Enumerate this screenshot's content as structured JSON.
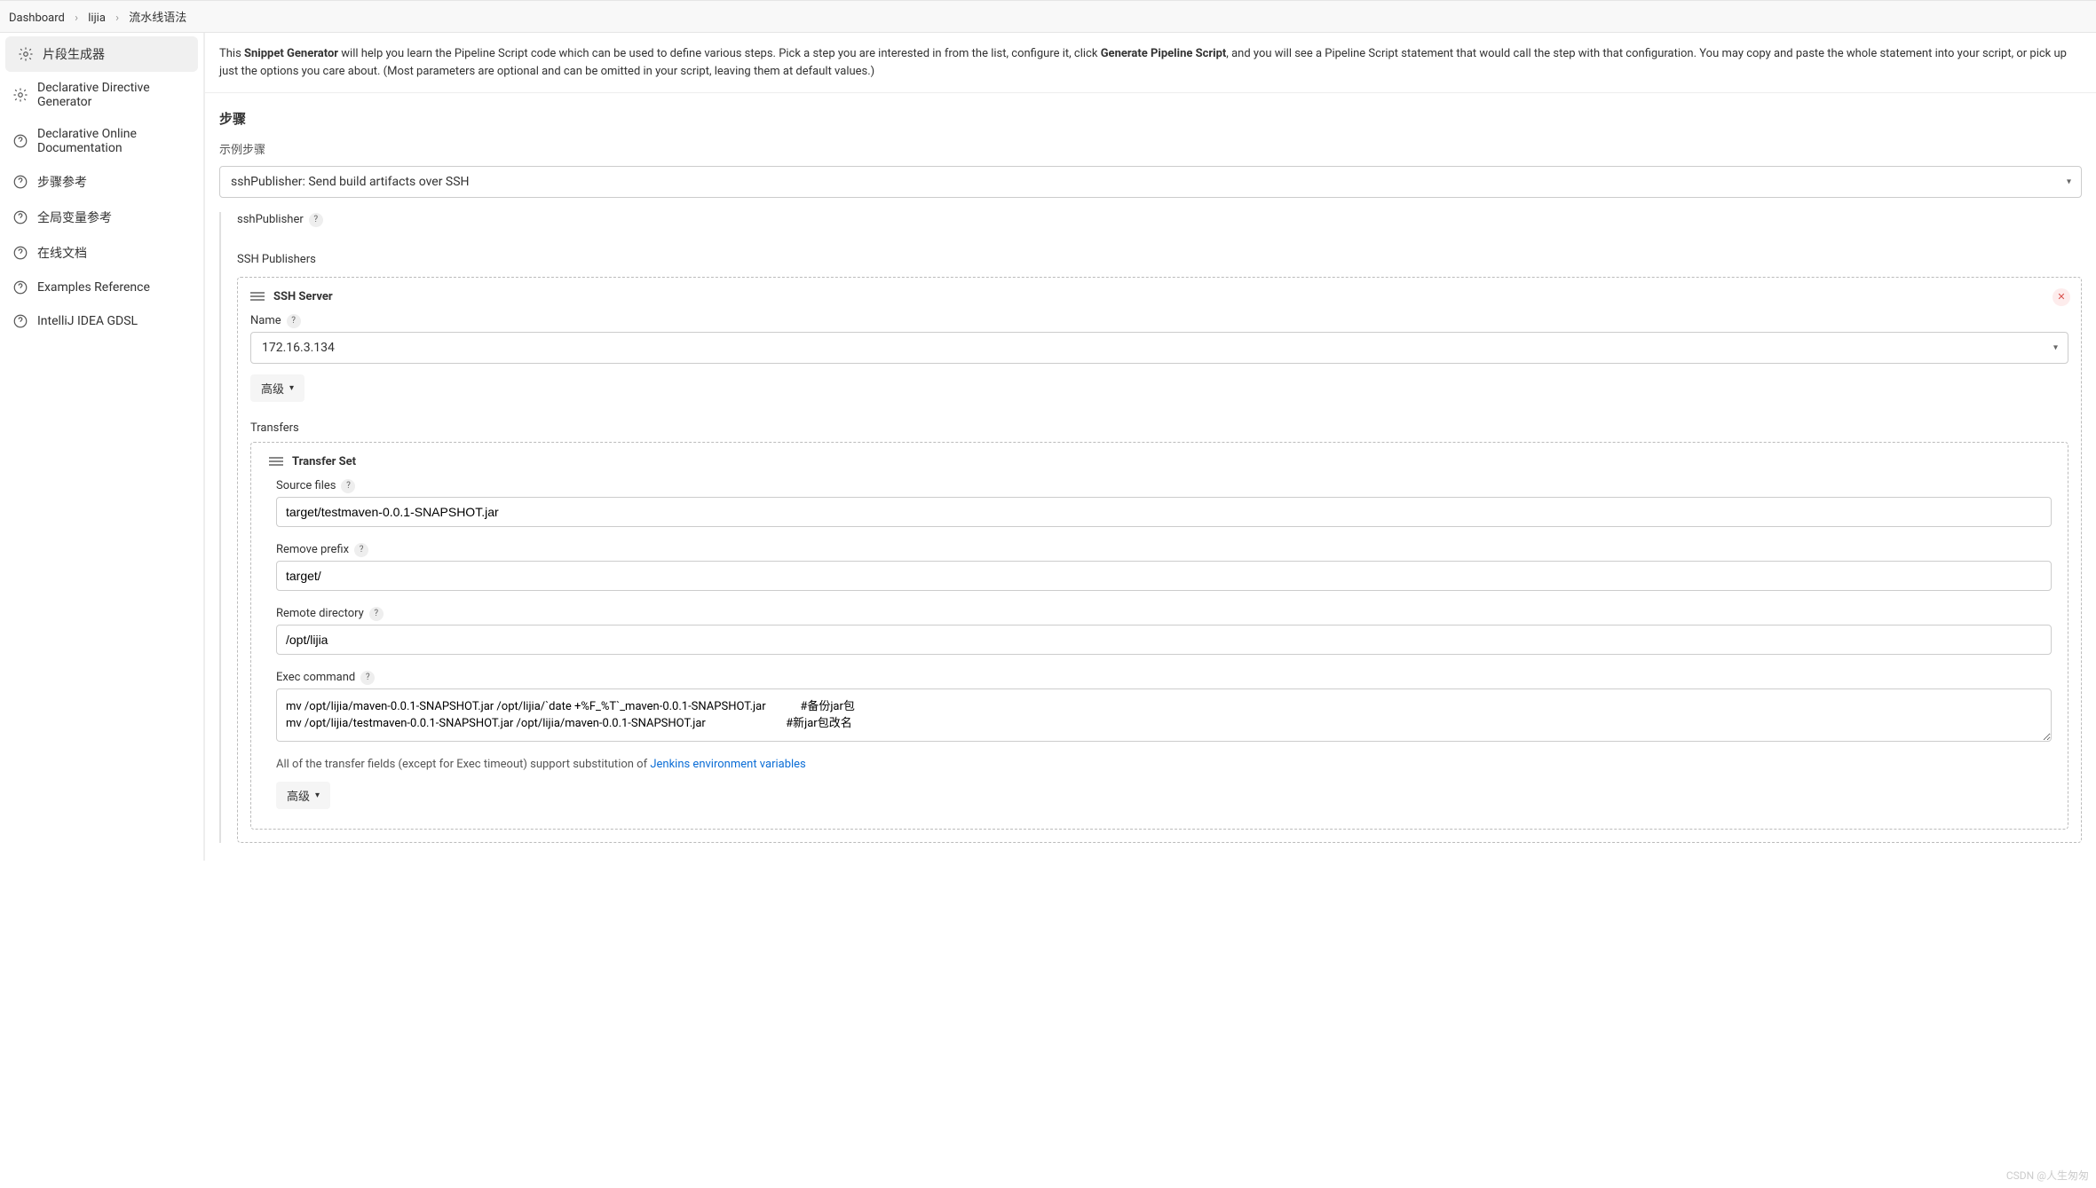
{
  "breadcrumb": {
    "dashboard": "Dashboard",
    "project": "lijia",
    "page": "流水线语法"
  },
  "sidebar": {
    "items": [
      {
        "label": "片段生成器"
      },
      {
        "label": "Declarative Directive Generator"
      },
      {
        "label": "Declarative Online Documentation"
      },
      {
        "label": "步骤参考"
      },
      {
        "label": "全局变量参考"
      },
      {
        "label": "在线文档"
      },
      {
        "label": "Examples Reference"
      },
      {
        "label": "IntelliJ IDEA GDSL"
      }
    ]
  },
  "intro": {
    "pre": "This ",
    "bold1": "Snippet Generator",
    "mid": " will help you learn the Pipeline Script code which can be used to define various steps. Pick a step you are interested in from the list, configure it, click ",
    "bold2": "Generate Pipeline Script",
    "post": ", and you will see a Pipeline Script statement that would call the step with that configuration. You may copy and paste the whole statement into your script, or pick up just the options you care about. (Most parameters are optional and can be omitted in your script, leaving them at default values.)"
  },
  "steps": {
    "heading": "步骤",
    "sample_label": "示例步骤",
    "selected": "sshPublisher: Send build artifacts over SSH"
  },
  "ssh": {
    "title": "sshPublisher",
    "publishers_label": "SSH Publishers",
    "server": {
      "header": "SSH Server",
      "name_label": "Name",
      "name_value": "172.16.3.134",
      "advanced": "高级"
    },
    "transfers_label": "Transfers",
    "transfer": {
      "header": "Transfer Set",
      "source_label": "Source files",
      "source_value": "target/testmaven-0.0.1-SNAPSHOT.jar",
      "remove_prefix_label": "Remove prefix",
      "remove_prefix_value": "target/",
      "remote_dir_label": "Remote directory",
      "remote_dir_value": "/opt/lijia",
      "exec_label": "Exec command",
      "exec_value": "mv /opt/lijia/maven-0.0.1-SNAPSHOT.jar /opt/lijia/`date +%F_%T`_maven-0.0.1-SNAPSHOT.jar            #备份jar包\nmv /opt/lijia/testmaven-0.0.1-SNAPSHOT.jar /opt/lijia/maven-0.0.1-SNAPSHOT.jar                            #新jar包改名",
      "note_pre": "All of the transfer fields (except for Exec timeout) support substitution of ",
      "note_link": "Jenkins environment variables",
      "advanced": "高级"
    }
  },
  "watermark": "CSDN @人生匆匆"
}
